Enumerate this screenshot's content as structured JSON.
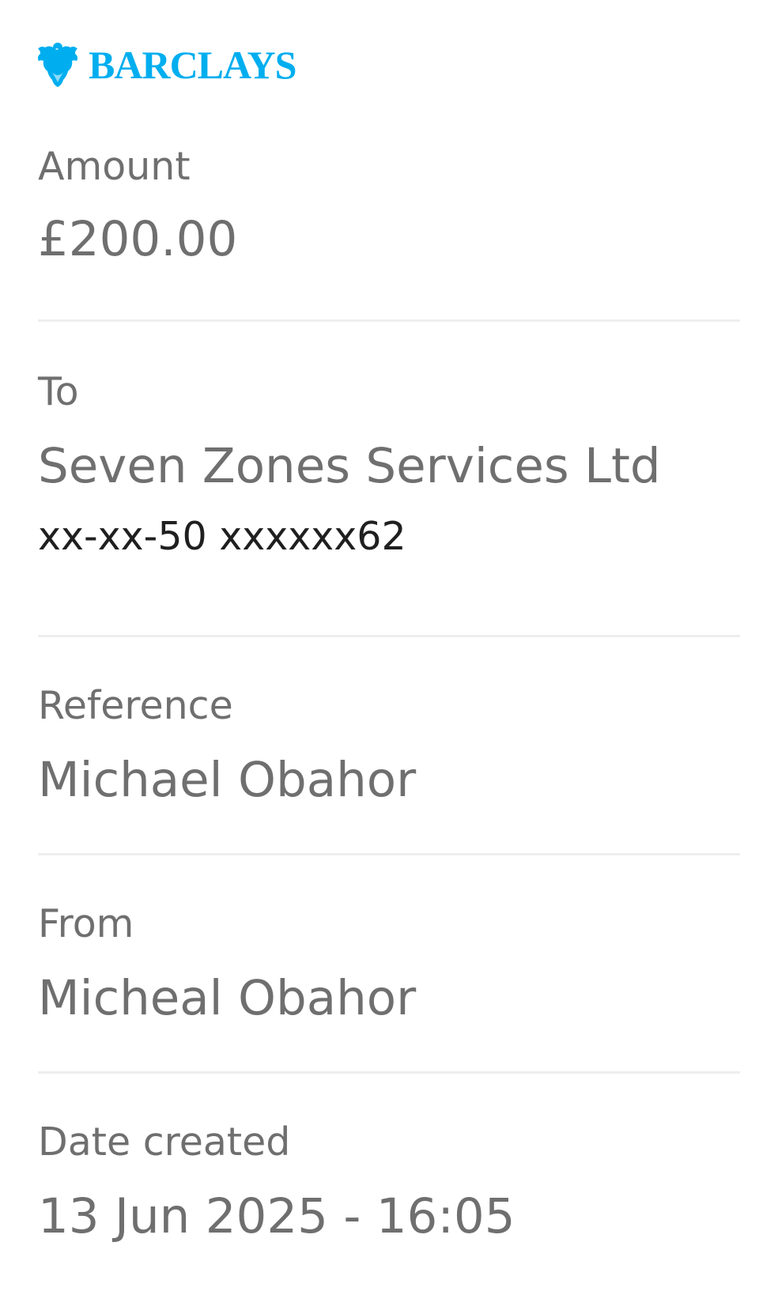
{
  "logo": {
    "wordmark": "BARCLAYS",
    "icon": "eagle-icon",
    "color": "#00aeef"
  },
  "amount": {
    "label": "Amount",
    "value": "£200.00"
  },
  "to": {
    "label": "To",
    "name": "Seven Zones Services Ltd",
    "account": "xx-xx-50 xxxxxx62"
  },
  "reference": {
    "label": "Reference",
    "value": "Michael Obahor"
  },
  "from": {
    "label": "From",
    "value": "Micheal Obahor"
  },
  "date_created": {
    "label": "Date created",
    "value": "13 Jun 2025 - 16:05"
  },
  "colors": {
    "text_muted": "#6f6f6f",
    "text_dark": "#1f1f1f",
    "divider": "#eeeeee",
    "background": "#ffffff"
  }
}
